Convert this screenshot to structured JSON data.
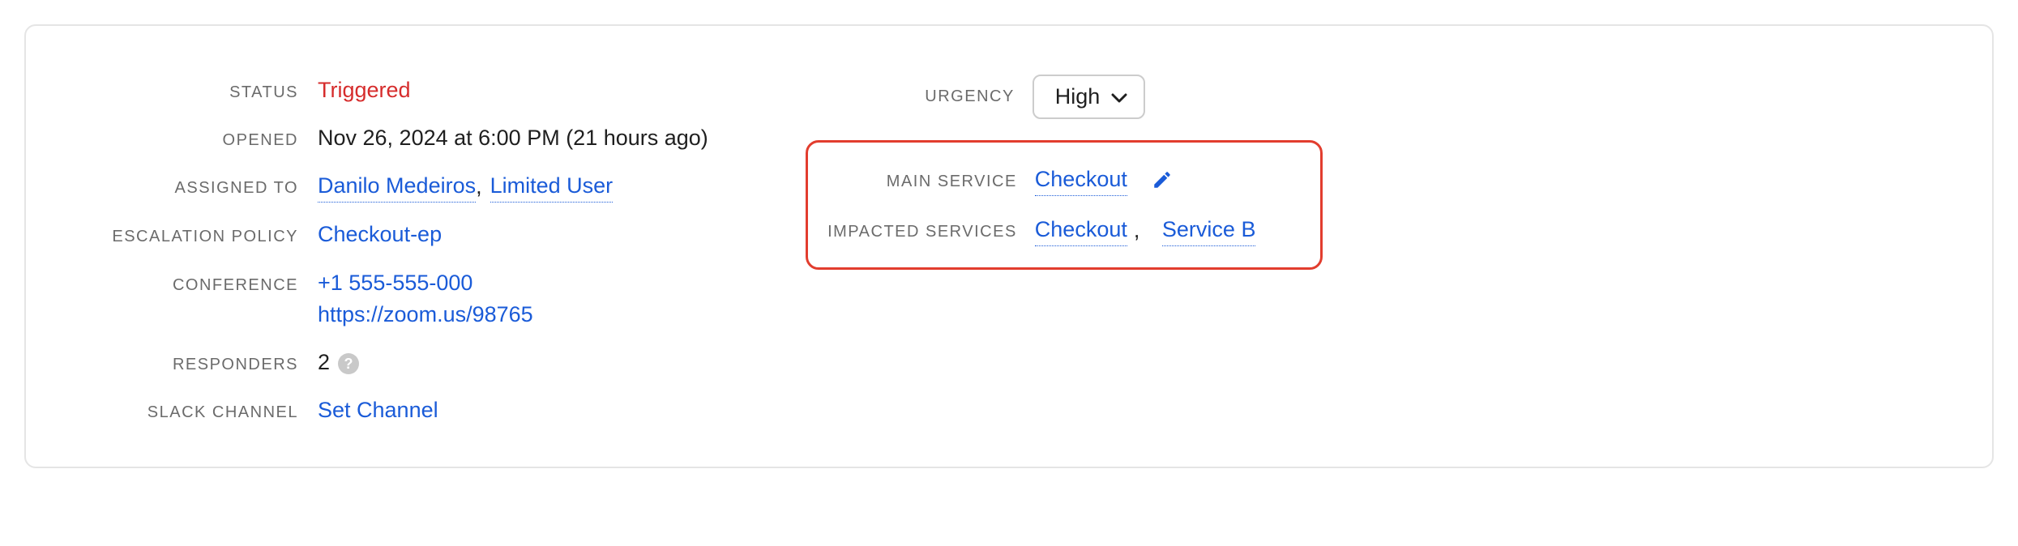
{
  "left": {
    "status_label": "STATUS",
    "status_value": "Triggered",
    "opened_label": "OPENED",
    "opened_value": "Nov 26, 2024 at 6:00 PM (21 hours ago)",
    "assigned_label": "ASSIGNED TO",
    "assigned": [
      "Danilo Medeiros",
      "Limited User"
    ],
    "escalation_label": "ESCALATION POLICY",
    "escalation_value": "Checkout-ep",
    "conference_label": "CONFERENCE",
    "conference_phone": "+1 555-555-000",
    "conference_url": "https://zoom.us/98765",
    "responders_label": "RESPONDERS",
    "responders_value": "2",
    "slack_label": "SLACK CHANNEL",
    "slack_value": "Set Channel"
  },
  "right": {
    "urgency_label": "URGENCY",
    "urgency_value": "High",
    "main_service_label": "MAIN SERVICE",
    "main_service_value": "Checkout",
    "impacted_label": "IMPACTED SERVICES",
    "impacted": [
      "Checkout",
      "Service B"
    ]
  },
  "sep": ","
}
